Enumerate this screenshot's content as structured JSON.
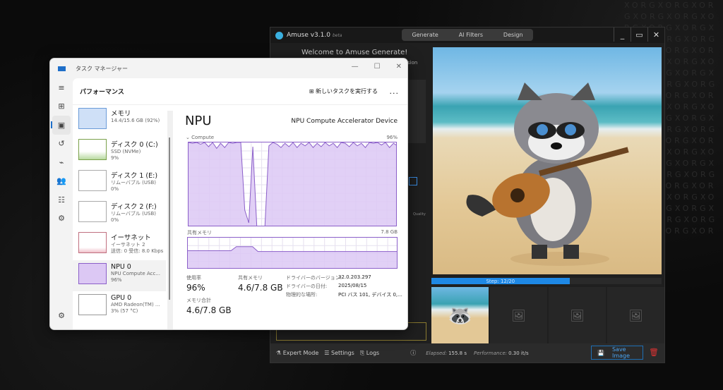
{
  "amuse": {
    "title": "Amuse v3.1.0",
    "beta": "beta",
    "tabs": [
      "Generate",
      "AI Filters",
      "Design"
    ],
    "welcome": "Welcome to Amuse Generate!",
    "partial_text": "sion",
    "quality_label": "Quality",
    "progress": {
      "label": "Step: 12/20",
      "step": 12,
      "total": 20
    },
    "footer": {
      "expert_mode": "Expert Mode",
      "settings": "Settings",
      "logs": "Logs",
      "elapsed_label": "Elapsed:",
      "elapsed_value": "155.8 s",
      "performance_label": "Performance:",
      "performance_value": "0.30 it/s",
      "save": "Save Image"
    },
    "accent": "#1e88e5"
  },
  "taskmanager": {
    "title": "タスク マネージャー",
    "section": "パフォーマンス",
    "new_task": "新しいタスクを実行する",
    "more": "...",
    "items": [
      {
        "name": "メモリ",
        "sub1": "14.4/15.6 GB (92%)",
        "sub2": ""
      },
      {
        "name": "ディスク 0 (C:)",
        "sub1": "SSD (NVMe)",
        "sub2": "9%"
      },
      {
        "name": "ディスク 1 (E:)",
        "sub1": "リムーバブル (USB)",
        "sub2": "0%"
      },
      {
        "name": "ディスク 2 (F:)",
        "sub1": "リムーバブル (USB)",
        "sub2": "0%"
      },
      {
        "name": "イーサネット",
        "sub1": "イーサネット 2",
        "sub2": "送信: 0 受信: 8.0 Kbps"
      },
      {
        "name": "NPU 0",
        "sub1": "NPU Compute Acc...",
        "sub2": "96%"
      },
      {
        "name": "GPU 0",
        "sub1": "AMD Radeon(TM) ...",
        "sub2": "3% (57 °C)"
      }
    ],
    "detail": {
      "title": "NPU",
      "device": "NPU Compute Accelerator Device",
      "compute_label": "Compute",
      "compute_max": "96%",
      "shared_label": "共有メモリ",
      "shared_max": "7.8 GB",
      "usage_label": "使用率",
      "usage_value": "96%",
      "shared_mem_label": "共有メモリ",
      "shared_mem_value": "4.6/7.8 GB",
      "total_label": "メモリ合計",
      "total_value": "4.6/7.8 GB",
      "driver_version_label": "ドライバーのバージョン:",
      "driver_version": "32.0.203.297",
      "driver_date_label": "ドライバーの日付:",
      "driver_date": "2025/08/15",
      "location_label": "物理的な場所:",
      "location": "PCI バス 101, デバイス 0,..."
    },
    "compute_history": [
      100,
      99,
      100,
      98,
      100,
      95,
      100,
      93,
      99,
      94,
      100,
      99,
      100,
      100,
      20,
      5,
      95,
      0,
      0,
      0,
      96,
      100,
      98,
      94,
      99,
      95,
      100,
      94,
      99,
      96,
      100,
      94,
      99,
      95,
      100,
      96,
      99,
      94,
      100,
      99,
      95,
      100,
      96,
      99,
      94,
      100,
      99,
      100,
      97,
      100,
      94,
      99,
      96
    ],
    "shared_history_gb": [
      4.6,
      4.6,
      4.6,
      4.6,
      4.6,
      4.6,
      4.6,
      4.6,
      4.6,
      5.6,
      5.6,
      5.6,
      5.6,
      4.4,
      4.4,
      4.4,
      4.4,
      4.4,
      4.4,
      4.4,
      4.4,
      4.4,
      4.4,
      4.4,
      4.4,
      4.4,
      4.4,
      4.4,
      4.4,
      4.4,
      4.4,
      4.4,
      4.4,
      4.4,
      4.4,
      4.4,
      4.4,
      4.4,
      4.4,
      4.4
    ],
    "shared_max_gb": 7.8,
    "accent": "#8b5fc9"
  }
}
